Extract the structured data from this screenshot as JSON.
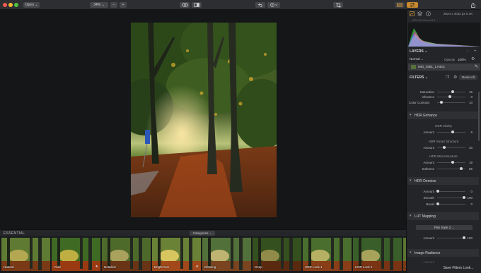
{
  "titlebar": {
    "open_label": "Open ⌄",
    "zoom_value": "34% ⌄",
    "minus_label": "−",
    "plus_label": "+"
  },
  "panel": {
    "image_info": "3024 x 4032 px   0.4K",
    "exif": "ISO 100   4.2mm   f/1.8",
    "layers_title": "LAYERS ⌄",
    "opacity_label": "Opacity",
    "opacity_value": "100%",
    "layer_name": "IMG_0381_1.HEIC",
    "filters_title": "FILTERS ⌄",
    "reset_label": "Reset All",
    "top_sliders": [
      {
        "label": "Saturation",
        "value": "15",
        "pos": 0.55
      },
      {
        "label": "Vibrance",
        "value": "0",
        "pos": 0.45
      },
      {
        "label": "Color Contrast",
        "value": "10",
        "pos": 0.15
      }
    ],
    "hdr_enhance": {
      "title": "HDR Enhance",
      "clarity_title": "HDR Clarity",
      "clarity_amount": {
        "label": "Amount",
        "value": "6",
        "pos": 0.55
      },
      "smart_title": "HDR Smart Structure",
      "smart_amount": {
        "label": "Amount",
        "value": "30",
        "pos": 0.25
      },
      "micro_title": "HDR Microstructure",
      "micro_amount": {
        "label": "Amount",
        "value": "19",
        "pos": 0.55
      },
      "micro_softness": {
        "label": "Softness",
        "value": "86",
        "pos": 0.85
      }
    },
    "hdr_denoise": {
      "title": "HDR Denoise",
      "amount": {
        "label": "Amount",
        "value": "0",
        "pos": 0.02
      },
      "smooth": {
        "label": "Smooth",
        "value": "100",
        "pos": 0.95
      },
      "boost": {
        "label": "Boost",
        "value": "0",
        "pos": 0.02
      }
    },
    "lut": {
      "title": "LUT Mapping",
      "preset": "Film Style 2 ⌄",
      "amount": {
        "label": "Amount",
        "value": "100",
        "pos": 0.95
      }
    },
    "image_radiance": {
      "title": "Image Radiance",
      "amount_label": "Amount"
    },
    "save_label": "Save Filters Look..."
  },
  "filmstrip": {
    "title": "ESSENTIAL",
    "categories_label": "Categories ⌄",
    "thumbs": [
      {
        "label": "Natural",
        "starred": false
      },
      {
        "label": "Vivid",
        "starred": true
      },
      {
        "label": "Detailed",
        "starred": false
      },
      {
        "label": "Bright Sun",
        "starred": true
      },
      {
        "label": "Glowing",
        "starred": false
      },
      {
        "label": "Deep",
        "starred": false
      },
      {
        "label": "HDR Look 1",
        "starred": false
      },
      {
        "label": "HDR Look 2",
        "starred": false
      },
      {
        "label": "Tr",
        "starred": false
      }
    ],
    "star_glyph": "★"
  },
  "colors": {
    "accent": "#d59b3c",
    "panel_bg": "#242528",
    "canvas_bg": "#151617"
  }
}
